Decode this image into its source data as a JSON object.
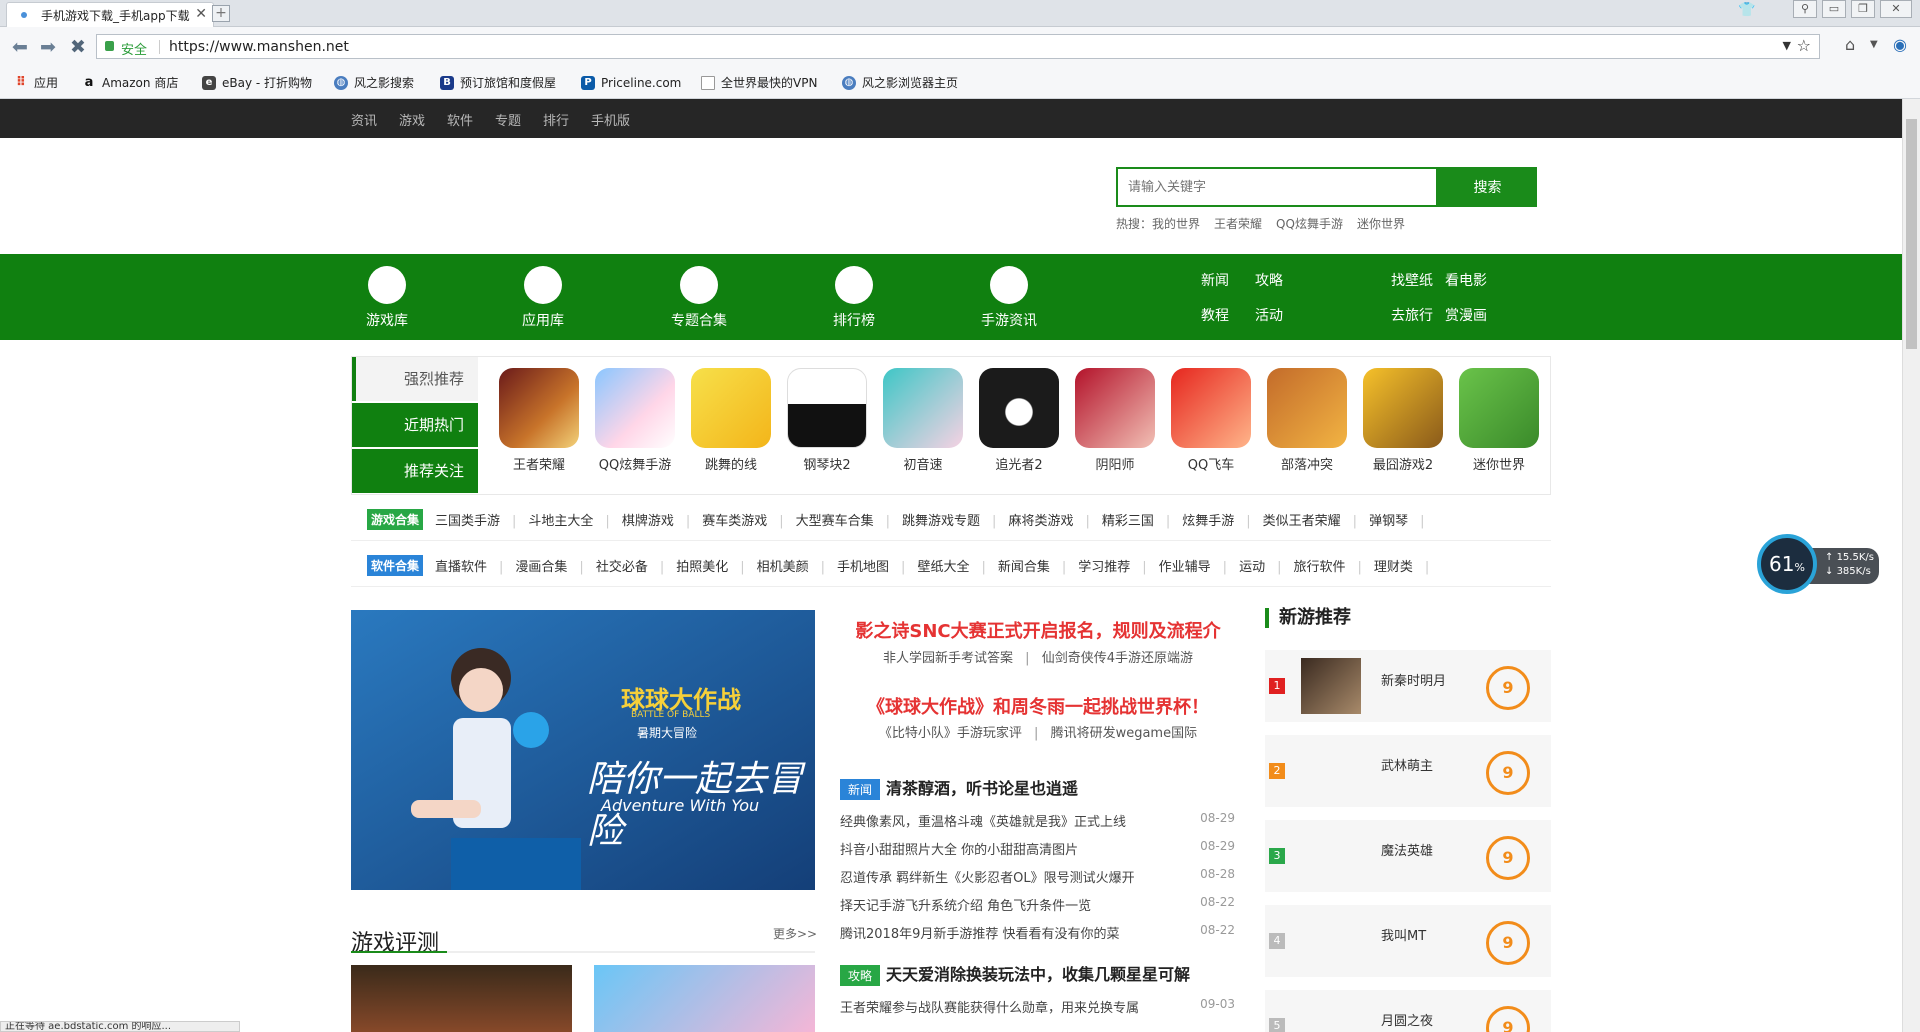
{
  "tab": {
    "title": "手机游戏下载_手机app下载",
    "new_tab": "+"
  },
  "address": {
    "secure_label": "安全",
    "url": "https://www.manshen.net"
  },
  "bookmarks": [
    {
      "label": "应用",
      "icon": "apps-grid-icon"
    },
    {
      "label": "Amazon 商店",
      "icon": "amazon-icon"
    },
    {
      "label": "eBay - 打折购物",
      "icon": "ebay-icon"
    },
    {
      "label": "风之影搜索",
      "icon": "globe-icon"
    },
    {
      "label": "预订旅馆和度假屋",
      "icon": "booking-icon"
    },
    {
      "label": "Priceline.com",
      "icon": "priceline-icon"
    },
    {
      "label": "全世界最快的VPN",
      "icon": "page-icon"
    },
    {
      "label": "风之影浏览器主页",
      "icon": "globe-icon"
    }
  ],
  "topnav": [
    "资讯",
    "游戏",
    "软件",
    "专题",
    "排行",
    "手机版"
  ],
  "search": {
    "placeholder": "请输入关键字",
    "button": "搜索",
    "hot_label": "热搜：",
    "hot": [
      "我的世界",
      "王者荣耀",
      "QQ炫舞手游",
      "迷你世界"
    ]
  },
  "green_nav": {
    "categories": [
      "游戏库",
      "应用库",
      "专题合集",
      "排行榜",
      "手游资讯"
    ],
    "links": [
      "新闻",
      "攻略",
      "教程",
      "活动",
      "找壁纸",
      "看电影",
      "去旅行",
      "赏漫画"
    ]
  },
  "recommend": {
    "tabs": [
      "强烈推荐",
      "近期热门",
      "推荐关注"
    ],
    "apps": [
      "王者荣耀",
      "QQ炫舞手游",
      "跳舞的线",
      "钢琴块2",
      "初音速",
      "追光者2",
      "阴阳师",
      "QQ飞车",
      "部落冲突",
      "最囧游戏2",
      "迷你世界"
    ]
  },
  "game_tags": {
    "label": "游戏合集",
    "items": [
      "三国类手游",
      "斗地主大全",
      "棋牌游戏",
      "赛车类游戏",
      "大型赛车合集",
      "跳舞游戏专题",
      "麻将类游戏",
      "精彩三国",
      "炫舞手游",
      "类似王者荣耀",
      "弹钢琴"
    ]
  },
  "soft_tags": {
    "label": "软件合集",
    "items": [
      "直播软件",
      "漫画合集",
      "社交必备",
      "拍照美化",
      "相机美颜",
      "手机地图",
      "壁纸大全",
      "新闻合集",
      "学习推荐",
      "作业辅导",
      "运动",
      "旅行软件",
      "理财类"
    ]
  },
  "headlines": [
    {
      "title": "影之诗SNC大赛正式开启报名，规则及流程介",
      "subs": [
        "非人学园新手考试答案",
        "仙剑奇侠传4手游还原端游"
      ]
    },
    {
      "title": "《球球大作战》和周冬雨一起挑战世界杯！",
      "subs": [
        "《比特小队》手游玩家评",
        "腾讯将研发wegame国际"
      ]
    }
  ],
  "news_block": {
    "tag": "新闻",
    "title": "清茶醇酒，听书论星也逍遥",
    "rows": [
      {
        "text": "经典像素风，重温格斗魂《英雄就是我》正式上线",
        "date": "08-29"
      },
      {
        "text": "抖音小甜甜照片大全 你的小甜甜高清图片",
        "date": "08-29"
      },
      {
        "text": "忍道传承 羁绊新生《火影忍者OL》限号测试火爆开",
        "date": "08-28"
      },
      {
        "text": "择天记手游飞升系统介绍 角色飞升条件一览",
        "date": "08-22"
      },
      {
        "text": "腾讯2018年9月新手游推荐 快看看有没有你的菜",
        "date": "08-22"
      }
    ]
  },
  "guide_block": {
    "tag": "攻略",
    "title": "天天爱消除换装玩法中，收集几颗星星可解",
    "rows": [
      {
        "text": "王者荣耀参与战队赛能获得什么勋章，用来兑换专属",
        "date": "09-03"
      }
    ]
  },
  "banner": {
    "title": "球球大作战",
    "subtitle": "BATTLE OF BALLS",
    "tagline": "暑期大冒险",
    "slogan": "陪你一起去冒险",
    "english": "Adventure With You"
  },
  "review": {
    "title": "游戏评测",
    "more": "更多>>"
  },
  "new_games": {
    "title": "新游推荐",
    "items": [
      {
        "rank": "1",
        "name": "新秦时明月",
        "score": "9"
      },
      {
        "rank": "2",
        "name": "武林萌主",
        "score": "9"
      },
      {
        "rank": "3",
        "name": "魔法英雄",
        "score": "9"
      },
      {
        "rank": "4",
        "name": "我叫MT",
        "score": "9"
      },
      {
        "rank": "5",
        "name": "月圆之夜",
        "score": "9"
      }
    ]
  },
  "speed": {
    "percent": "61",
    "up": "15.5K/s",
    "down": "385K/s"
  },
  "status_text": "正在等待 ae.bdstatic.com 的响应...",
  "colors": {
    "brand_green": "#108010",
    "headline_red": "#e53333",
    "score_orange": "#f28c1a"
  }
}
